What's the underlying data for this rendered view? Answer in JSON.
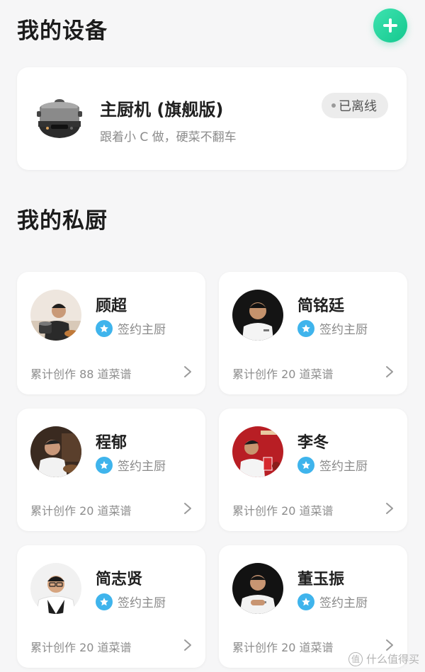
{
  "devices": {
    "title": "我的设备",
    "items": [
      {
        "name": "主厨机 (旗舰版)",
        "description": "跟着小 C 做，硬菜不翻车",
        "status": "已离线"
      }
    ]
  },
  "chefs": {
    "title": "我的私厨",
    "items": [
      {
        "name": "顾超",
        "badge": "签约主厨",
        "stats": "累计创作 88 道菜谱"
      },
      {
        "name": "简铭廷",
        "badge": "签约主厨",
        "stats": "累计创作 20 道菜谱"
      },
      {
        "name": "程郁",
        "badge": "签约主厨",
        "stats": "累计创作 20 道菜谱"
      },
      {
        "name": "李冬",
        "badge": "签约主厨",
        "stats": "累计创作 20 道菜谱"
      },
      {
        "name": "简志贤",
        "badge": "签约主厨",
        "stats": "累计创作 20 道菜谱"
      },
      {
        "name": "董玉振",
        "badge": "签约主厨",
        "stats": "累计创作 20 道菜谱"
      }
    ]
  },
  "watermark": {
    "text": "什么值得买",
    "icon": "值"
  },
  "colors": {
    "accent": "#14c88e",
    "badge": "#3fb4ec",
    "background": "#f6f6f7"
  }
}
